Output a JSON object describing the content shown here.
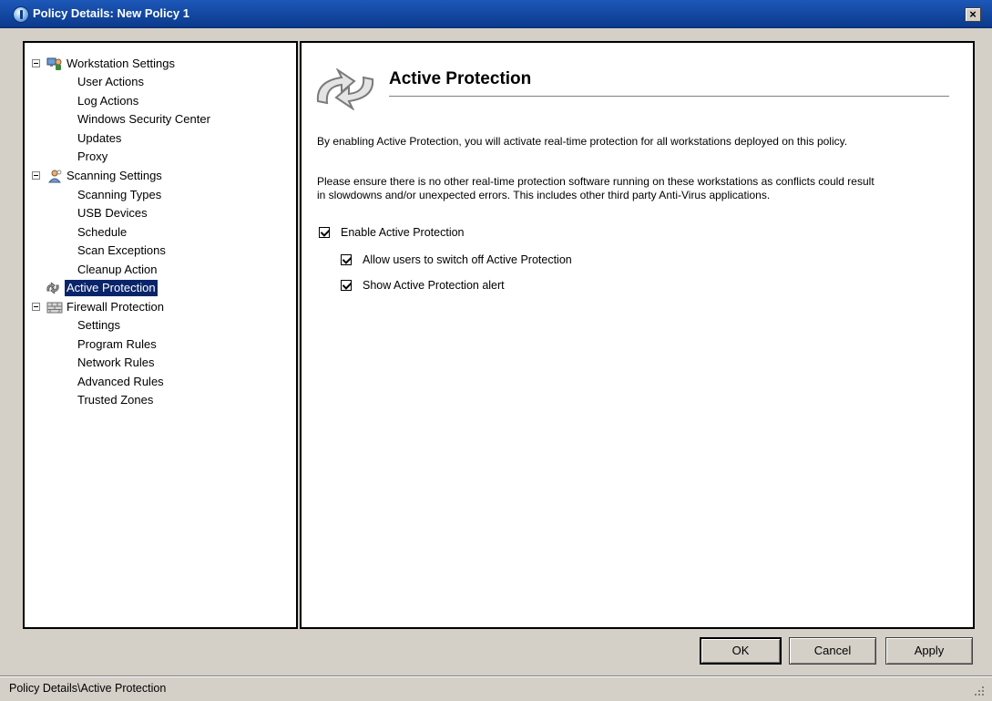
{
  "window": {
    "title": "Policy Details: New Policy 1",
    "close_label": "×"
  },
  "tree": {
    "workstation": {
      "label": "Workstation Settings",
      "items": [
        "User Actions",
        "Log Actions",
        "Windows Security Center",
        "Updates",
        "Proxy"
      ]
    },
    "scanning": {
      "label": "Scanning Settings",
      "items": [
        "Scanning Types",
        "USB Devices",
        "Schedule",
        "Scan Exceptions",
        "Cleanup Action"
      ]
    },
    "active_protection": {
      "label": "Active Protection",
      "selected": true
    },
    "firewall": {
      "label": "Firewall Protection",
      "items": [
        "Settings",
        "Program Rules",
        "Network Rules",
        "Advanced Rules",
        "Trusted Zones"
      ]
    }
  },
  "content": {
    "title": "Active Protection",
    "para1": "By enabling Active Protection, you will activate real-time protection for all workstations deployed on this policy.",
    "para2_line1": "Please ensure there is no other real-time protection software running on these workstations as conflicts could result",
    "para2_line2": "in slowdowns and/or unexpected errors. This includes other third party Anti-Virus applications.",
    "checks": {
      "enable": {
        "label": "Enable Active Protection",
        "checked": true
      },
      "allow_switch_off": {
        "label": "Allow users to switch off Active Protection",
        "checked": true
      },
      "show_alert": {
        "label": "Show Active Protection alert",
        "checked": true
      }
    }
  },
  "buttons": {
    "ok": "OK",
    "cancel": "Cancel",
    "apply": "Apply"
  },
  "status": {
    "text": "Policy Details\\Active Protection"
  },
  "colors": {
    "titlebar": "#1d58b8",
    "selection": "#0a246a",
    "face": "#d4d0c8"
  }
}
